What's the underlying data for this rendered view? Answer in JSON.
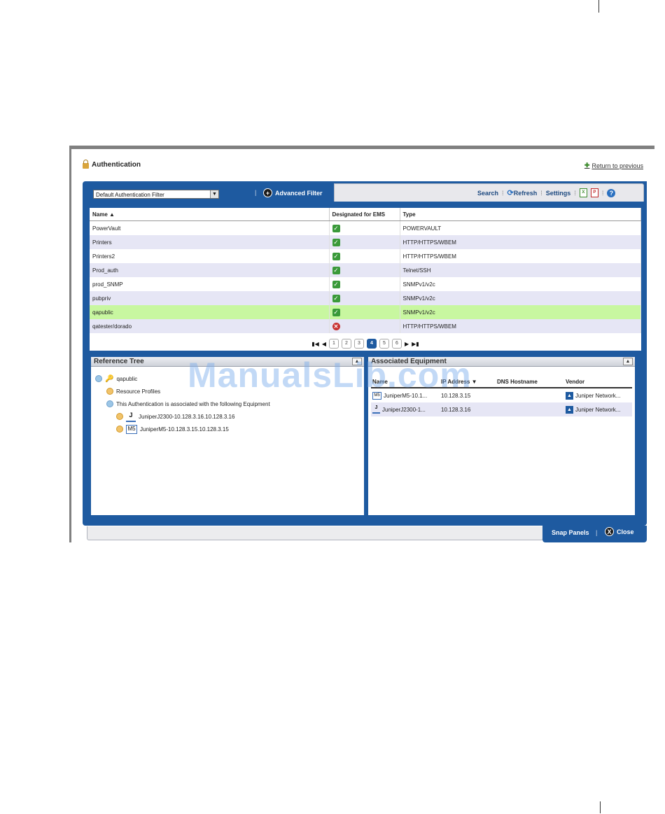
{
  "window": {
    "title": "Authentication",
    "return_label": "Return to previous"
  },
  "toolbar": {
    "filter_value": "Default Authentication Filter",
    "advanced_filter_label": "Advanced Filter",
    "search_label": "Search",
    "refresh_label": "Refresh",
    "settings_label": "Settings",
    "xls_label": "X",
    "pdf_label": "P",
    "help_label": "?"
  },
  "grid": {
    "columns": [
      "Name ▲",
      "Designated for EMS",
      "Type"
    ],
    "rows": [
      {
        "name": "PowerVault",
        "type": "POWERVAULT"
      },
      {
        "name": "Printers",
        "type": "HTTP/HTTPS/WBEM"
      },
      {
        "name": "Printers2",
        "type": "HTTP/HTTPS/WBEM"
      },
      {
        "name": "Prod_auth",
        "type": "Telnet/SSH"
      },
      {
        "name": "prod_SNMP",
        "type": "SNMPv1/v2c"
      },
      {
        "name": "pubpriv",
        "type": "SNMPv1/v2c"
      },
      {
        "name": "qapublic",
        "type": "SNMPv1/v2c"
      },
      {
        "name": "qatester/dorado",
        "type": "HTTP/HTTPS/WBEM"
      }
    ]
  },
  "pager": {
    "pages": [
      "1",
      "2",
      "3",
      "4",
      "5",
      "6"
    ]
  },
  "reference_tree": {
    "title": "Reference Tree",
    "root": "qapublic",
    "resource_profiles": "Resource Profiles",
    "associated_label": "This Authentication is associated with the following Equipment",
    "devices": [
      "JuniperJ2300-10.128.3.16.10.128.3.16",
      "JuniperM5-10.128.3.15.10.128.3.15"
    ]
  },
  "associated_equipment": {
    "title": "Associated Equipment",
    "columns": [
      "Name",
      "IP Address",
      "DNS Hostname",
      "Vendor"
    ],
    "rows": [
      {
        "name": "JuniperM5-10.1...",
        "ip": "10.128.3.15",
        "dns": "",
        "vendor": "Juniper Network..."
      },
      {
        "name": "JuniperJ2300-1...",
        "ip": "10.128.3.16",
        "dns": "",
        "vendor": "Juniper Network..."
      }
    ]
  },
  "footer": {
    "snap_label": "Snap Panels",
    "close_label": "Close"
  },
  "watermark": "ManualsLib.com"
}
